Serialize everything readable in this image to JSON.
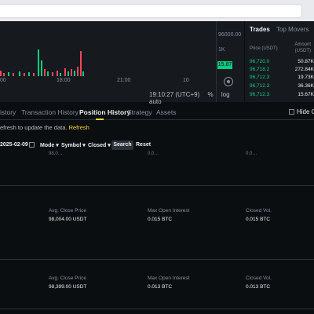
{
  "chart": {
    "price_labels": [
      "96000.00",
      "1K"
    ],
    "volume_badge": "15.87",
    "times": [
      "00",
      "18:00",
      "21:00",
      "10"
    ],
    "clock": "19:10:27 (UTC+9)",
    "controls": [
      "%",
      "log",
      "auto"
    ],
    "colors": {
      "up": "#0ecb81",
      "down": "#f6465d"
    }
  },
  "trades": {
    "tabs": [
      "Trades",
      "Top Movers"
    ],
    "header_price": "Price (USDT)",
    "header_amount_line1": "Amount",
    "header_amount_line2": "(USDT)",
    "rows": [
      {
        "price": "96,720.0",
        "amount": "50.87K"
      },
      {
        "price": "96,718.2",
        "amount": "272.84K"
      },
      {
        "price": "96,712.3",
        "amount": "19.73K"
      },
      {
        "price": "96,712.3",
        "amount": "36.36K"
      },
      {
        "price": "96,712.3",
        "amount": "15.67K"
      }
    ]
  },
  "positions": {
    "tabs": [
      "istory",
      "Transaction History",
      "Position History",
      "Strategy",
      "Assets"
    ],
    "hide_other": "Hide Ot",
    "refresh_text": "efresh to update the data.",
    "refresh_link": "Refresh",
    "filters": {
      "date": "2025-02-09",
      "mode": "Mode",
      "symbol": "Symbol",
      "status": "Closed",
      "search": "Search",
      "reset": "Reset"
    },
    "cut_values": [
      "98,0…",
      "0.0…",
      "0.0…"
    ],
    "rows": [
      {
        "avg_close_label": "Avg. Close Price",
        "avg_close_value": "98,004.00 USDT",
        "max_oi_label": "Max Open Interest",
        "max_oi_value": "0.015 BTC",
        "closed_vol_label": "Closed Vol.",
        "closed_vol_value": "0.015 BTC"
      },
      {
        "avg_close_label": "Avg. Close Price",
        "avg_close_value": "98,399.00 USDT",
        "max_oi_label": "Max Open Interest",
        "max_oi_value": "0.013 BTC",
        "closed_vol_label": "Closed Vol.",
        "closed_vol_value": "0.013 BTC"
      }
    ]
  }
}
